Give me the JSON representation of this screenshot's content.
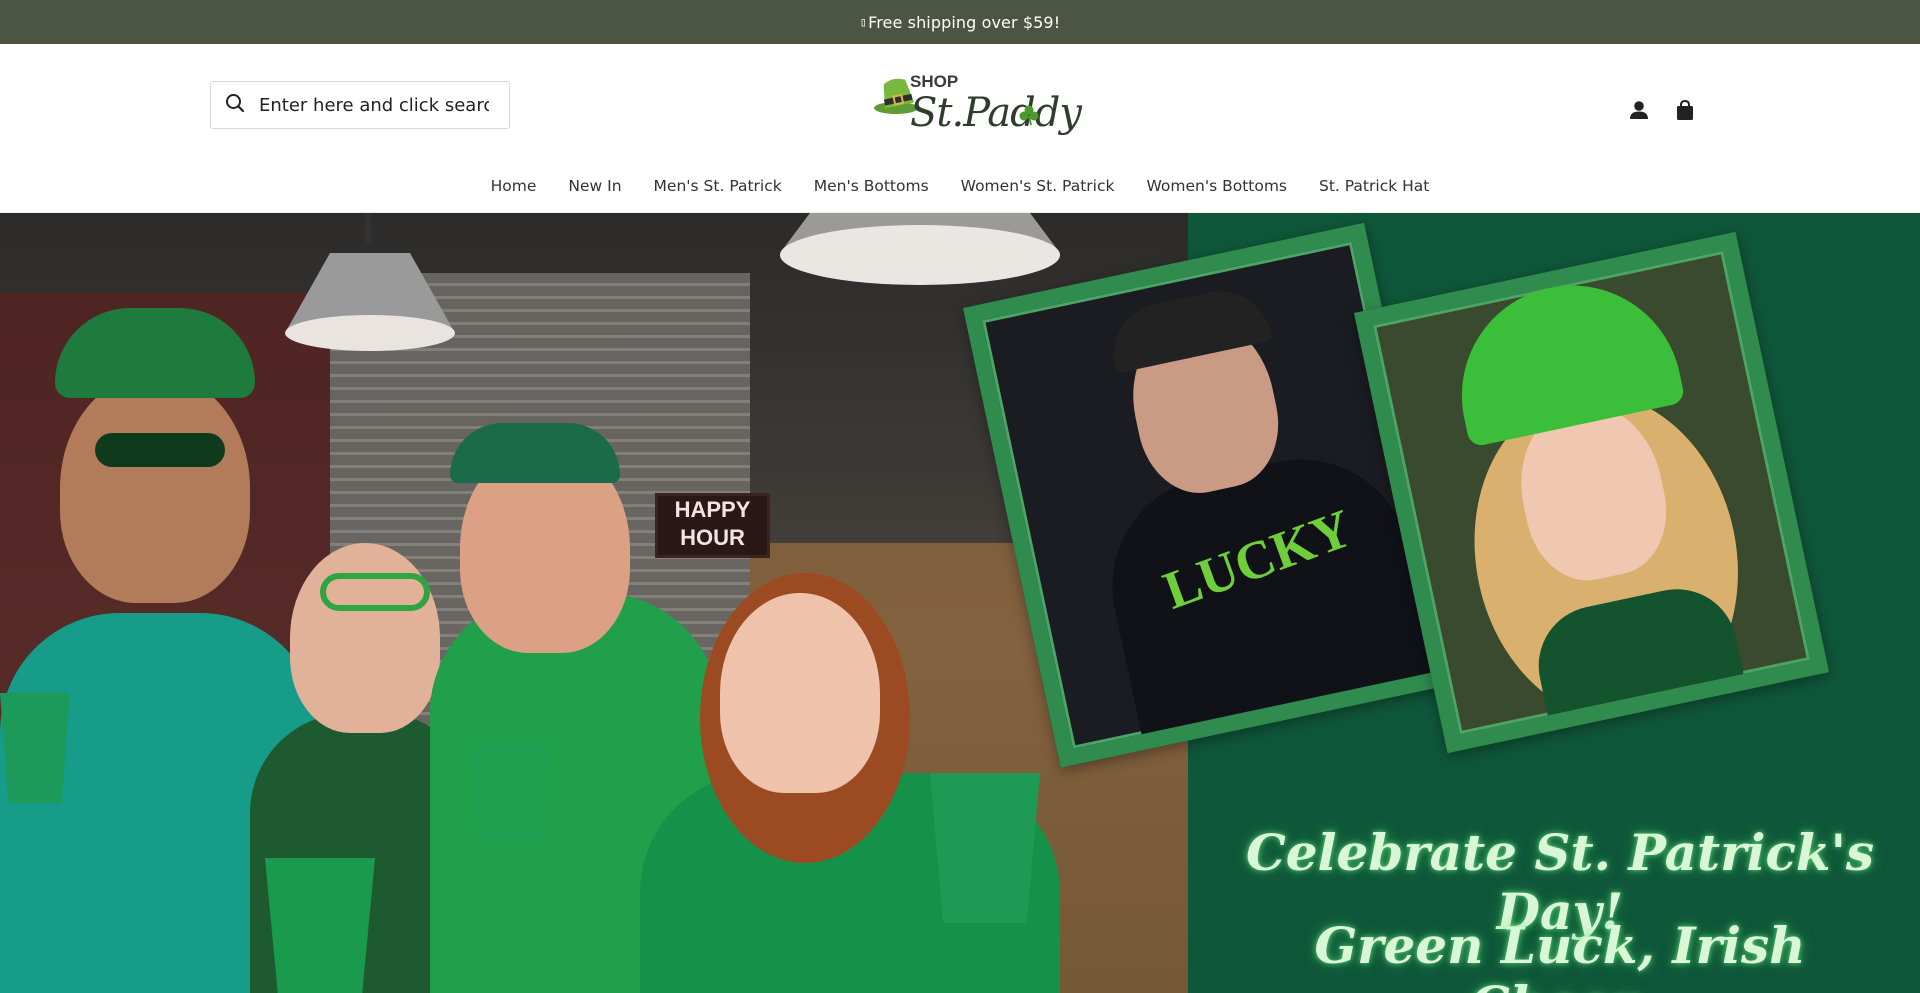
{
  "announcement": {
    "icon": "box-glyph",
    "text": "Free shipping over $59!"
  },
  "header": {
    "search": {
      "placeholder": "Enter here and click search"
    },
    "logo": {
      "shop_text": "SHOP",
      "script_text": "St.Paddy"
    },
    "actions": [
      {
        "icon": "user-icon"
      },
      {
        "icon": "shopping-bag-icon"
      }
    ]
  },
  "nav": {
    "items": [
      {
        "label": "Home"
      },
      {
        "label": "New In"
      },
      {
        "label": "Men's St. Patrick"
      },
      {
        "label": "Men's Bottoms"
      },
      {
        "label": "Women's St. Patrick"
      },
      {
        "label": "Women's Bottoms"
      },
      {
        "label": "St. Patrick Hat"
      }
    ]
  },
  "hero": {
    "sign_text": "HAPPY HOUR",
    "sweatshirt_text": "LUCKY",
    "headline_1": "Celebrate St. Patrick's Day!",
    "headline_2": "Green Luck, Irish Cheer,"
  },
  "colors": {
    "announcement_bg": "#4c5544",
    "hero_green": "#0f573a",
    "headline": "#d9f6d6"
  }
}
